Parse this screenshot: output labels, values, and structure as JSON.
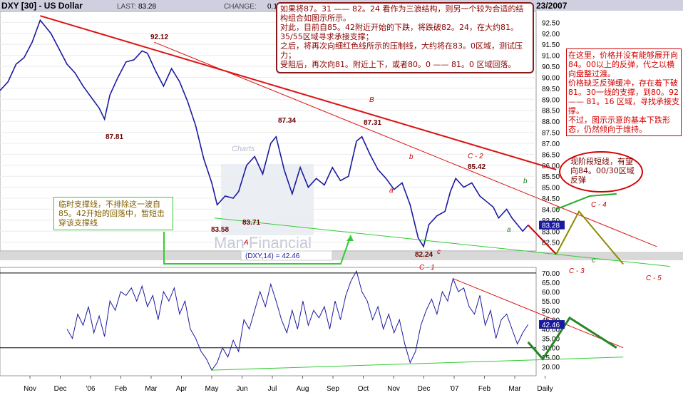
{
  "header": {
    "symbol": "DXY [30] - US Dollar",
    "last_label": "LAST:",
    "last_value": "83.28",
    "change_label": "CHANGE:",
    "change_value": "0.1",
    "date": "23/2007"
  },
  "watermark": {
    "line1": "Charts",
    "line2": "Man Financial"
  },
  "notes": {
    "top": "如果将87。31 —— 82。24 看作为三浪结构，则另一个较为合适的结构组合如图示所示。\n对此，目前自85。42附近开始的下跌，将跌破82。24，在大约81。35/55区域寻求承接支撑；\n之后，将再次向细红色线所示的压制线，大约将在83。0区域，测试压力；\n受阻后，再次向81。附近上下，或者80。0 —— 81。0 区域回落。",
    "right": "在这里，价格并没有能够展开向84。00以上的反弹，代之以横向盘整过渡。\n价格缺乏反弹缓冲，存在着下破81。30一线的支撑，到80。92 —— 81。16 区域，寻找承接支撑。\n不过，图示示意的基本下跌形态，仍然倾向于维持。",
    "short": "现阶段短线，有望向84。00/30区域反弹",
    "left": "临时支撑线，不排除这一波自85。42开始的回落中，暂短击穿该支撑线"
  },
  "indicator_label": "(DXY,14) = 42.46",
  "price_labels": [
    "92.12",
    "87.81",
    "87.34",
    "87.31",
    "85.42",
    "83.58",
    "83.71",
    "82.24"
  ],
  "wave_labels": [
    "A",
    "B",
    "a",
    "b",
    "C - 2",
    "b",
    "a",
    "c",
    "C - 1",
    "C - 3",
    "c",
    "C - 4",
    "C - 5"
  ],
  "last_price_tag": "83.28",
  "last_rsi_tag": "42.46",
  "chart_data": [
    {
      "type": "line",
      "title": "DXY [30] - US Dollar",
      "x_labels": [
        "Nov",
        "Dec",
        "'06",
        "Feb",
        "Mar",
        "Apr",
        "May",
        "Jun",
        "Jul",
        "Aug",
        "Sep",
        "Oct",
        "Nov",
        "Dec",
        "'07",
        "Feb",
        "Mar",
        "Daily"
      ],
      "y_ticks": [
        82.5,
        83.0,
        83.5,
        84.0,
        84.5,
        85.0,
        85.5,
        86.0,
        86.5,
        87.0,
        87.5,
        88.0,
        88.5,
        89.0,
        89.5,
        90.0,
        90.5,
        91.0,
        91.5,
        92.0,
        92.5
      ],
      "ylim": [
        82.1,
        93.0
      ],
      "xlim": [
        0,
        400
      ],
      "series": [
        {
          "points": [
            [
              0,
              89.4
            ],
            [
              6,
              89.8
            ],
            [
              12,
              90.6
            ],
            [
              18,
              90.9
            ],
            [
              24,
              91.6
            ],
            [
              30,
              92.6
            ],
            [
              34,
              92.3
            ],
            [
              38,
              92.0
            ],
            [
              44,
              91.3
            ],
            [
              50,
              90.6
            ],
            [
              56,
              90.2
            ],
            [
              62,
              89.6
            ],
            [
              68,
              89.1
            ],
            [
              74,
              88.6
            ],
            [
              78,
              88.1
            ],
            [
              82,
              89.2
            ],
            [
              88,
              90.0
            ],
            [
              94,
              90.7
            ],
            [
              100,
              90.8
            ],
            [
              106,
              91.2
            ],
            [
              110,
              91.1
            ],
            [
              116,
              90.3
            ],
            [
              122,
              89.6
            ],
            [
              128,
              90.4
            ],
            [
              134,
              89.8
            ],
            [
              140,
              88.9
            ],
            [
              146,
              87.8
            ],
            [
              152,
              86.3
            ],
            [
              158,
              85.2
            ],
            [
              162,
              84.2
            ],
            [
              168,
              84.6
            ],
            [
              174,
              84.5
            ],
            [
              178,
              84.8
            ],
            [
              184,
              86.0
            ],
            [
              190,
              86.4
            ],
            [
              196,
              85.6
            ],
            [
              202,
              87.0
            ],
            [
              206,
              87.3
            ],
            [
              212,
              85.8
            ],
            [
              218,
              84.7
            ],
            [
              224,
              85.9
            ],
            [
              230,
              85.0
            ],
            [
              236,
              85.4
            ],
            [
              242,
              85.1
            ],
            [
              248,
              85.9
            ],
            [
              254,
              85.3
            ],
            [
              260,
              85.5
            ],
            [
              266,
              87.1
            ],
            [
              270,
              87.3
            ],
            [
              276,
              86.5
            ],
            [
              282,
              85.8
            ],
            [
              288,
              85.4
            ],
            [
              294,
              84.9
            ],
            [
              300,
              85.2
            ],
            [
              306,
              84.2
            ],
            [
              312,
              82.7
            ],
            [
              316,
              82.3
            ],
            [
              320,
              83.3
            ],
            [
              326,
              83.7
            ],
            [
              332,
              83.9
            ],
            [
              336,
              84.8
            ],
            [
              340,
              85.4
            ],
            [
              346,
              85.0
            ],
            [
              352,
              85.2
            ],
            [
              358,
              84.6
            ],
            [
              364,
              84.3
            ],
            [
              368,
              84.1
            ],
            [
              372,
              83.6
            ],
            [
              378,
              84.0
            ],
            [
              382,
              83.6
            ],
            [
              386,
              83.3
            ],
            [
              390,
              83.0
            ],
            [
              394,
              83.28
            ]
          ]
        }
      ],
      "annotations": [
        {
          "kind": "resistance-thick",
          "from": [
            30,
            92.8
          ],
          "to": [
            415,
            85.8
          ],
          "color": "#dd1111"
        },
        {
          "kind": "resistance-thin",
          "from": [
            115,
            91.6
          ],
          "to": [
            490,
            82.3
          ],
          "color": "#dd1111"
        },
        {
          "kind": "support",
          "from": [
            160,
            83.6
          ],
          "to": [
            500,
            81.4
          ],
          "color": "#33cc33"
        },
        {
          "kind": "forecast-red",
          "points": [
            [
              394,
              83.28
            ],
            [
              415,
              81.95
            ]
          ],
          "color": "#cc0000"
        },
        {
          "kind": "forecast-olive",
          "points": [
            [
              415,
              81.95
            ],
            [
              432,
              83.9
            ],
            [
              465,
              81.5
            ]
          ],
          "color": "#8b8b00"
        },
        {
          "kind": "forecast-green",
          "points": [
            [
              415,
              84.0
            ],
            [
              440,
              84.6
            ],
            [
              460,
              84.7
            ]
          ],
          "color": "#22aa22"
        }
      ]
    },
    {
      "type": "line",
      "title": "(DXY,14) = 42.46",
      "y_ticks": [
        20.0,
        25.0,
        30.0,
        35.0,
        40.0,
        45.0,
        50.0,
        55.0,
        60.0,
        65.0,
        70.0
      ],
      "ylim": [
        15.0,
        73.0
      ],
      "hlines": [
        30.0,
        70.0
      ],
      "series": [
        {
          "points": [
            [
              50,
              40
            ],
            [
              54,
              35
            ],
            [
              58,
              48
            ],
            [
              62,
              42
            ],
            [
              66,
              52
            ],
            [
              70,
              38
            ],
            [
              74,
              47
            ],
            [
              78,
              36
            ],
            [
              82,
              55
            ],
            [
              86,
              50
            ],
            [
              90,
              60
            ],
            [
              94,
              58
            ],
            [
              98,
              62
            ],
            [
              102,
              55
            ],
            [
              106,
              63
            ],
            [
              110,
              52
            ],
            [
              114,
              58
            ],
            [
              118,
              45
            ],
            [
              122,
              60
            ],
            [
              126,
              55
            ],
            [
              130,
              62
            ],
            [
              134,
              48
            ],
            [
              138,
              55
            ],
            [
              142,
              40
            ],
            [
              146,
              35
            ],
            [
              150,
              28
            ],
            [
              154,
              24
            ],
            [
              158,
              18
            ],
            [
              162,
              22
            ],
            [
              166,
              30
            ],
            [
              170,
              25
            ],
            [
              174,
              34
            ],
            [
              178,
              28
            ],
            [
              182,
              45
            ],
            [
              186,
              40
            ],
            [
              190,
              50
            ],
            [
              194,
              60
            ],
            [
              198,
              52
            ],
            [
              202,
              64
            ],
            [
              206,
              55
            ],
            [
              210,
              45
            ],
            [
              214,
              38
            ],
            [
              218,
              50
            ],
            [
              222,
              40
            ],
            [
              226,
              55
            ],
            [
              230,
              42
            ],
            [
              234,
              50
            ],
            [
              238,
              46
            ],
            [
              242,
              52
            ],
            [
              246,
              40
            ],
            [
              250,
              55
            ],
            [
              254,
              45
            ],
            [
              258,
              58
            ],
            [
              262,
              66
            ],
            [
              266,
              71
            ],
            [
              270,
              60
            ],
            [
              274,
              55
            ],
            [
              278,
              45
            ],
            [
              282,
              52
            ],
            [
              286,
              40
            ],
            [
              290,
              48
            ],
            [
              294,
              38
            ],
            [
              298,
              45
            ],
            [
              302,
              32
            ],
            [
              306,
              22
            ],
            [
              310,
              28
            ],
            [
              314,
              42
            ],
            [
              318,
              50
            ],
            [
              322,
              56
            ],
            [
              326,
              48
            ],
            [
              330,
              60
            ],
            [
              334,
              55
            ],
            [
              338,
              67
            ],
            [
              342,
              60
            ],
            [
              346,
              62
            ],
            [
              350,
              52
            ],
            [
              354,
              48
            ],
            [
              358,
              58
            ],
            [
              362,
              42
            ],
            [
              366,
              50
            ],
            [
              370,
              35
            ],
            [
              374,
              45
            ],
            [
              378,
              48
            ],
            [
              382,
              40
            ],
            [
              386,
              32
            ],
            [
              390,
              38
            ],
            [
              394,
              42.46
            ]
          ]
        }
      ],
      "annotations": [
        {
          "kind": "resistance",
          "from": [
            338,
            67
          ],
          "to": [
            465,
            30
          ],
          "color": "#dd1111"
        },
        {
          "kind": "support",
          "from": [
            158,
            18
          ],
          "to": [
            465,
            25
          ],
          "color": "#33cc33"
        },
        {
          "kind": "forecast-green",
          "points": [
            [
              394,
              33
            ],
            [
              405,
              24
            ],
            [
              425,
              46
            ],
            [
              460,
              30
            ]
          ],
          "color": "#228822"
        }
      ]
    }
  ]
}
